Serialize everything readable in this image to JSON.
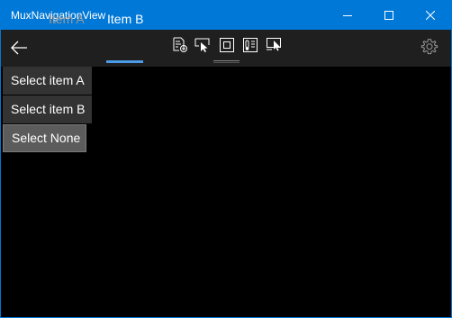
{
  "window": {
    "title": "MuxNavigationView",
    "accent_color": "#0078d7",
    "background": "#000000"
  },
  "caption_buttons": {
    "minimize_icon": "minimize-icon",
    "maximize_icon": "maximize-icon",
    "close_icon": "close-icon"
  },
  "navigation": {
    "back_icon": "back-arrow-icon",
    "items": [
      {
        "label": "Item A",
        "selected": false
      },
      {
        "label": "Item B",
        "selected": true
      }
    ],
    "selection_color": "#4c9be8",
    "settings_icon": "gear-icon"
  },
  "command_bar": {
    "icons": [
      "page-add-icon",
      "pointer-select-icon",
      "frame-icon",
      "thermometer-list-icon",
      "screen-pointer-icon"
    ]
  },
  "actions": {
    "select_a_label": "Select item A",
    "select_b_label": "Select item B",
    "select_none_label": "Select None"
  }
}
